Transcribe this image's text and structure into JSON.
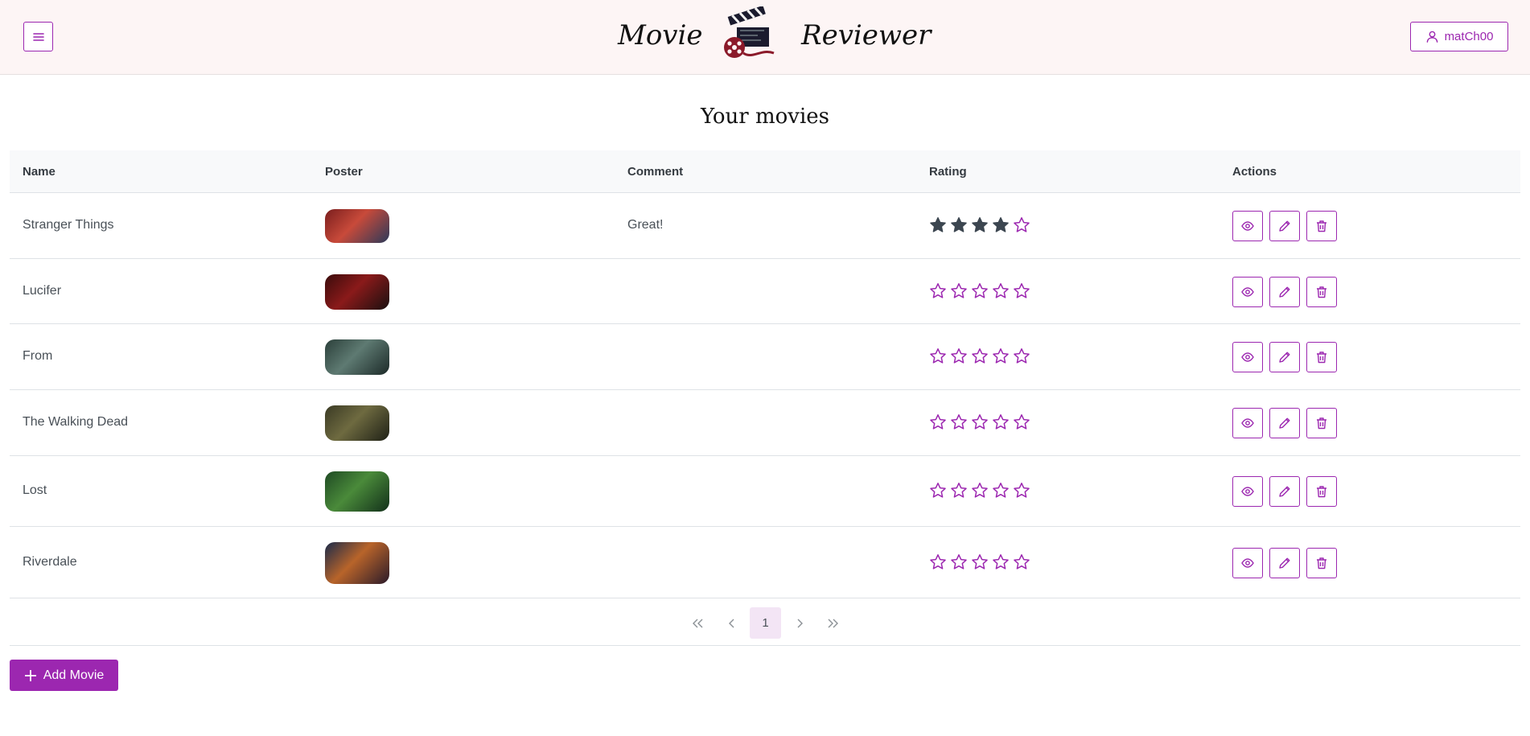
{
  "header": {
    "brand_left": "Movie",
    "brand_right": "Reviewer",
    "user_name": "matCh00",
    "accent": "#9c27b0"
  },
  "page_title": "Your movies",
  "table": {
    "columns": [
      "Name",
      "Poster",
      "Comment",
      "Rating",
      "Actions"
    ],
    "rows": [
      {
        "name": "Stranger Things",
        "comment": "Great!",
        "rating": 4,
        "poster_colors": [
          "#7a1e1e",
          "#c84a3a",
          "#2b3a5a"
        ]
      },
      {
        "name": "Lucifer",
        "comment": "",
        "rating": 0,
        "poster_colors": [
          "#3a0c0c",
          "#8a1a1a",
          "#1a1010"
        ]
      },
      {
        "name": "From",
        "comment": "",
        "rating": 0,
        "poster_colors": [
          "#2b3f3a",
          "#5e7a72",
          "#1c2a28"
        ]
      },
      {
        "name": "The Walking Dead",
        "comment": "",
        "rating": 0,
        "poster_colors": [
          "#3a3a24",
          "#6e6a40",
          "#1e2016"
        ]
      },
      {
        "name": "Lost",
        "comment": "",
        "rating": 0,
        "poster_colors": [
          "#1f4a24",
          "#4a8a3a",
          "#12301a"
        ]
      },
      {
        "name": "Riverdale",
        "comment": "",
        "rating": 0,
        "poster_colors": [
          "#1a2a4a",
          "#b8642a",
          "#2a1a2a"
        ]
      }
    ],
    "star_filled_color": "#3c4650",
    "star_empty_color": "#9c27b0"
  },
  "pagination": {
    "current_page": "1"
  },
  "add_button_label": "Add Movie",
  "icons": {
    "menu": "hamburger-icon",
    "user": "user-icon",
    "view": "eye-icon",
    "edit": "pencil-icon",
    "delete": "trash-icon",
    "first": "double-chevron-left-icon",
    "prev": "chevron-left-icon",
    "next": "chevron-right-icon",
    "last": "double-chevron-right-icon",
    "add": "plus-icon"
  }
}
